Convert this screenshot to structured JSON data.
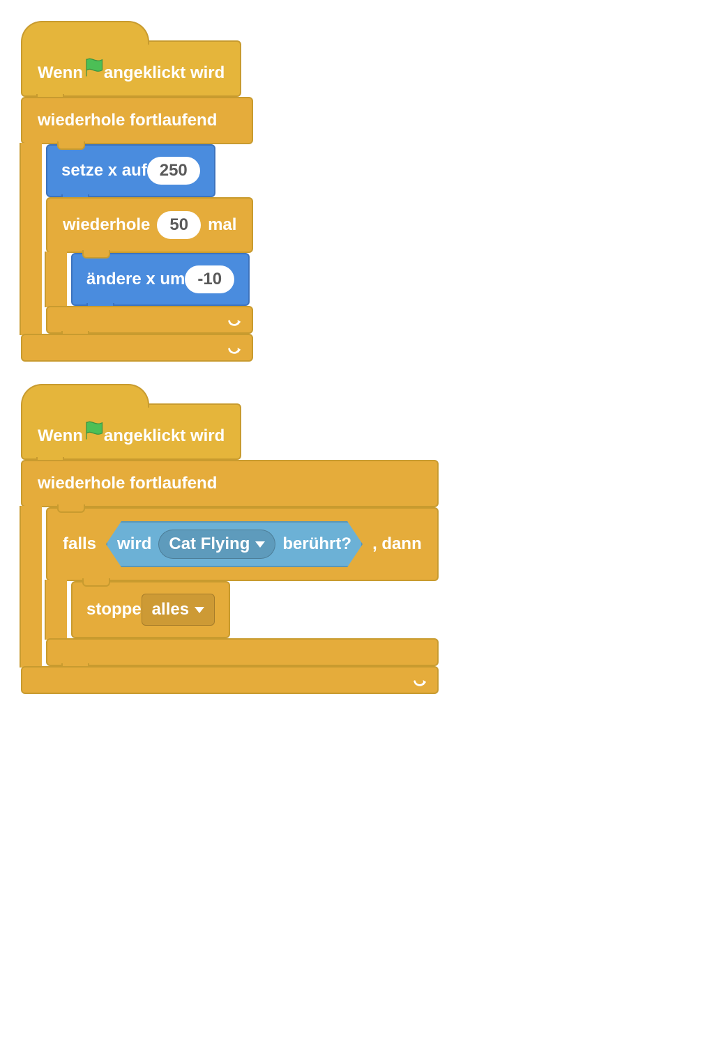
{
  "script1": {
    "hat_pre": "Wenn",
    "hat_post": "angeklickt wird",
    "forever": "wiederhole fortlaufend",
    "setx_pre": "setze x auf",
    "setx_val": "250",
    "repeat_pre": "wiederhole",
    "repeat_val": "50",
    "repeat_post": "mal",
    "changex_pre": "ändere x um",
    "changex_val": "-10"
  },
  "script2": {
    "hat_pre": "Wenn",
    "hat_post": "angeklickt wird",
    "forever": "wiederhole fortlaufend",
    "if_pre": "falls",
    "if_post": ", dann",
    "touch_pre": "wird",
    "touch_target": "Cat Flying",
    "touch_post": "berührt?",
    "stop_pre": "stoppe",
    "stop_opt": "alles"
  }
}
